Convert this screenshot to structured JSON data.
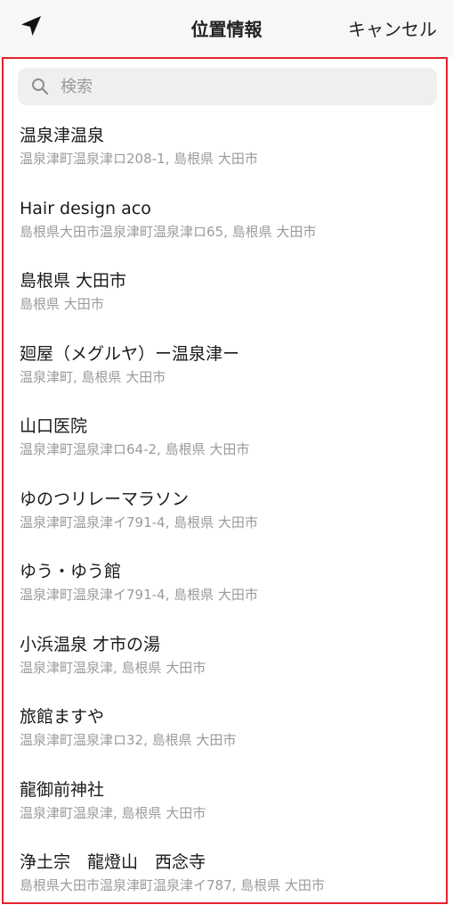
{
  "header": {
    "title": "位置情報",
    "cancel_label": "キャンセル",
    "location_icon": "location-arrow-icon"
  },
  "search": {
    "placeholder": "検索",
    "value": "",
    "icon": "search-icon"
  },
  "places": [
    {
      "name": "温泉津温泉",
      "address": "温泉津町温泉津ロ208-1, 島根県 大田市"
    },
    {
      "name": "Hair design aco",
      "address": "島根県大田市温泉津町温泉津ロ65, 島根県 大田市"
    },
    {
      "name": "島根県 大田市",
      "address": "島根県 大田市"
    },
    {
      "name": "廻屋（メグルヤ）ー温泉津ー",
      "address": "温泉津町, 島根県 大田市"
    },
    {
      "name": "山口医院",
      "address": "温泉津町温泉津ロ64-2, 島根県 大田市"
    },
    {
      "name": "ゆのつリレーマラソン",
      "address": "温泉津町温泉津イ791-4, 島根県 大田市"
    },
    {
      "name": "ゆう・ゆう館",
      "address": "温泉津町温泉津イ791-4, 島根県 大田市"
    },
    {
      "name": "小浜温泉 才市の湯",
      "address": "温泉津町温泉津, 島根県 大田市"
    },
    {
      "name": "旅館ますや",
      "address": "温泉津町温泉津ロ32, 島根県 大田市"
    },
    {
      "name": "龍御前神社",
      "address": "温泉津町温泉津, 島根県 大田市"
    },
    {
      "name": "浄土宗　龍燈山　西念寺",
      "address": "島根県大田市温泉津町温泉津イ787, 島根県 大田市"
    }
  ],
  "colors": {
    "highlight_border": "#e5212f",
    "header_bg": "#f7f7f7",
    "search_bg": "#efefef",
    "secondary_text": "#9b9b9b"
  }
}
